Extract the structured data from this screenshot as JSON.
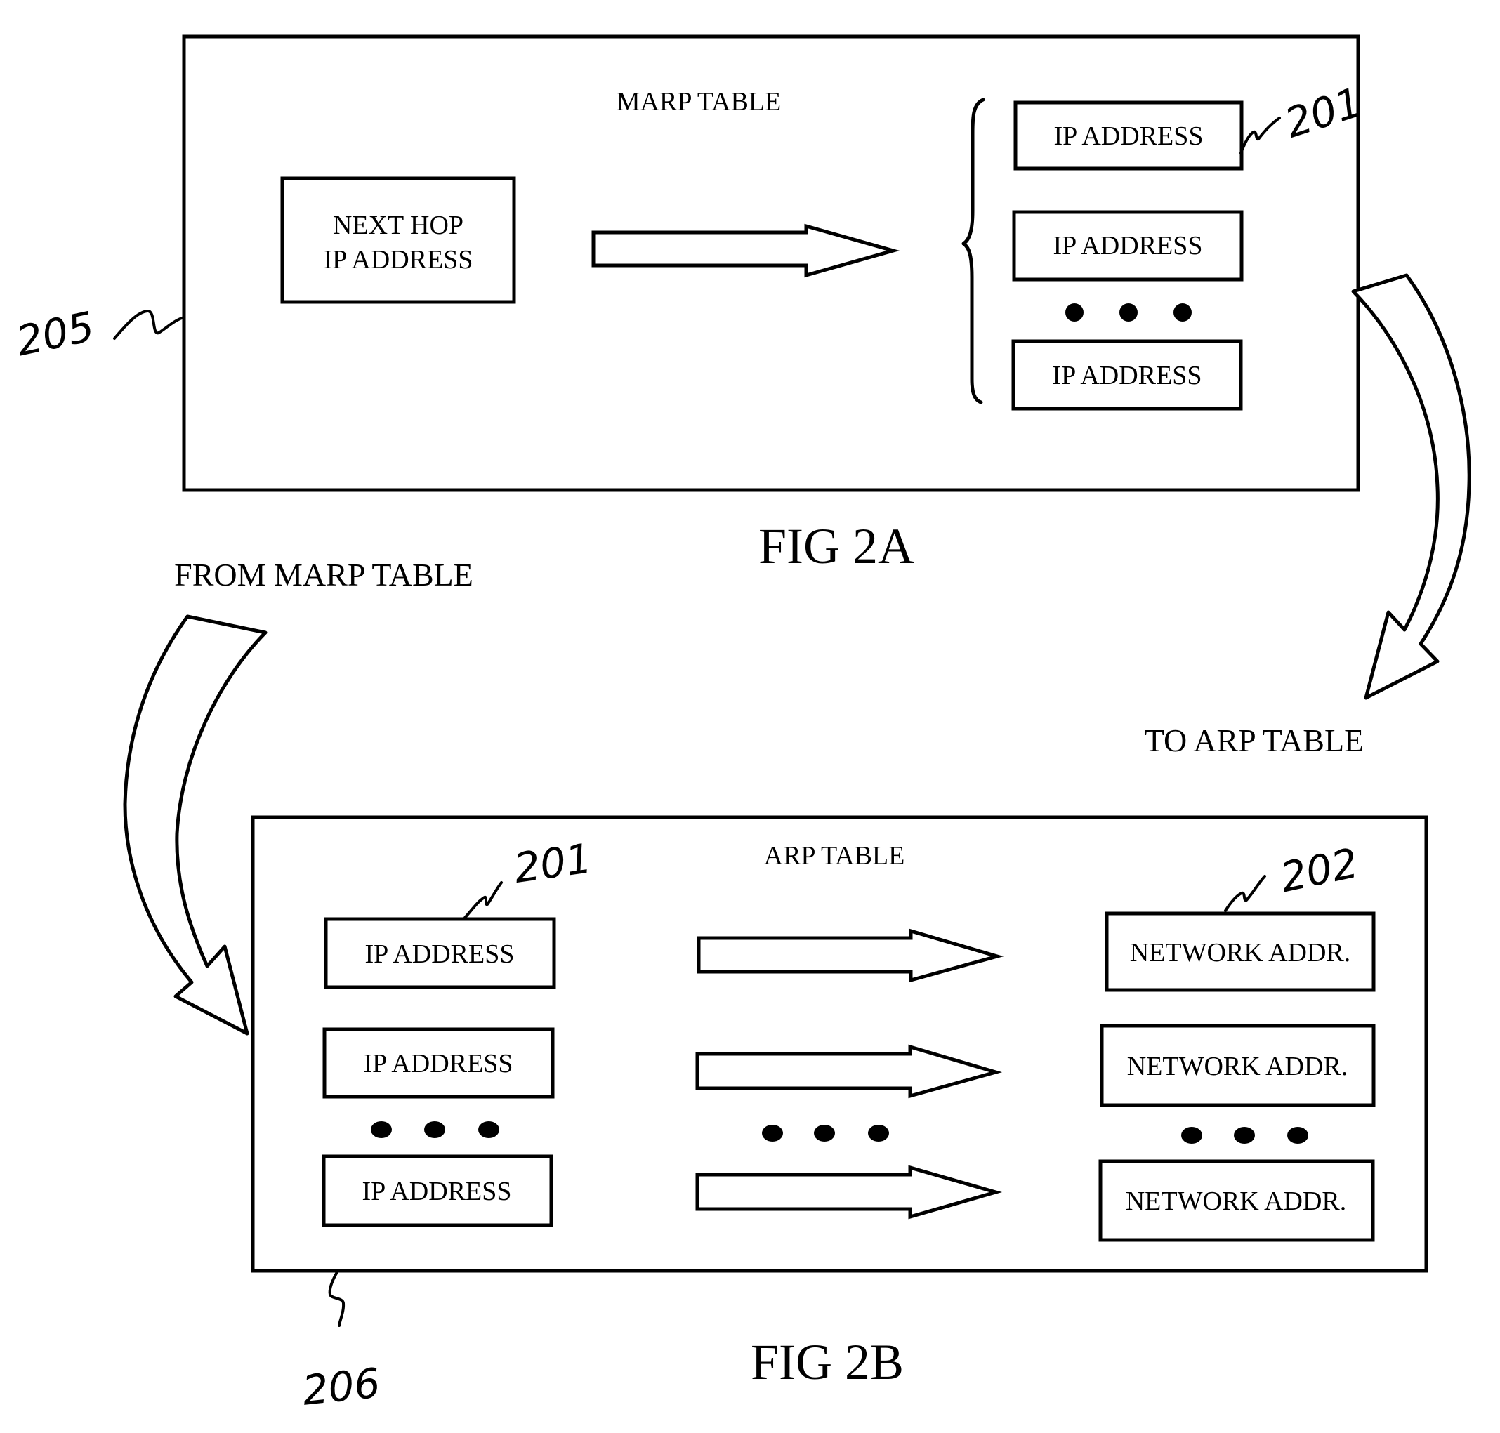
{
  "fig_2a": {
    "caption": "FIG 2A",
    "ref_number": "205",
    "table_title": "MARP TABLE",
    "source_box": {
      "line1": "NEXT HOP",
      "line2": "IP ADDRESS"
    },
    "target_ref_number": "201",
    "target_boxes": [
      {
        "label": "IP ADDRESS"
      },
      {
        "label": "IP ADDRESS"
      },
      {
        "label": "IP ADDRESS"
      }
    ],
    "ellipsis": "..."
  },
  "connectors": {
    "to_arp_label": "TO ARP TABLE",
    "from_marp_label": "FROM MARP TABLE"
  },
  "fig_2b": {
    "caption": "FIG 2B",
    "ref_number": "206",
    "table_title": "ARP TABLE",
    "left_ref_number": "201",
    "right_ref_number": "202",
    "rows": [
      {
        "ip": "IP ADDRESS",
        "network": "NETWORK ADDR."
      },
      {
        "ip": "IP ADDRESS",
        "network": "NETWORK ADDR."
      },
      {
        "ip": "IP ADDRESS",
        "network": "NETWORK ADDR."
      }
    ],
    "ellipsis": "..."
  },
  "colors": {
    "ink": "#000000",
    "paper": "#ffffff"
  }
}
